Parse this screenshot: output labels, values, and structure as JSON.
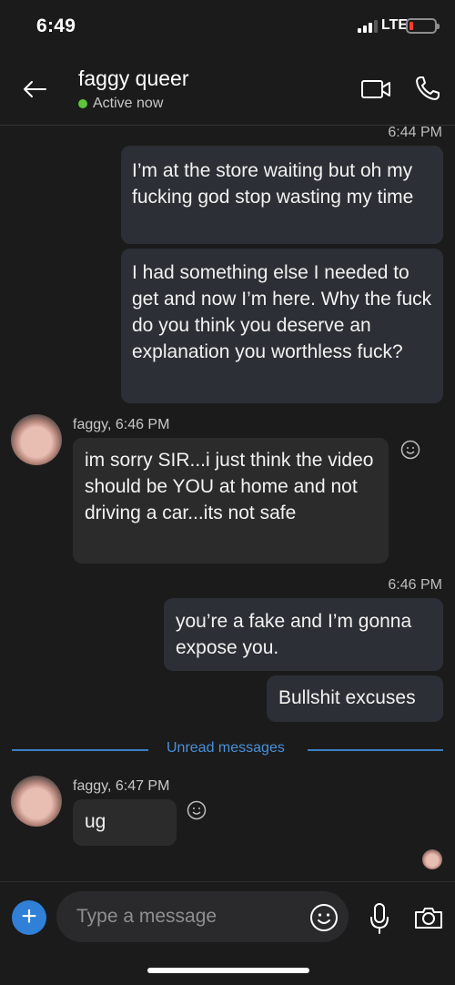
{
  "status_bar": {
    "time": "6:49",
    "network": "LTE",
    "battery_level": 0.08
  },
  "header": {
    "contact_name": "faggy queer",
    "presence": "Active now",
    "icons": [
      "back-arrow-icon",
      "video-call-icon",
      "phone-icon"
    ]
  },
  "conversation": {
    "timestamp_1": "6:44 PM",
    "out_1": "I’m at the store waiting but oh my fucking god stop wasting my time",
    "out_2": "I had something else I needed to get and now I’m here. Why the fuck do you think you deserve an explanation you worthless fuck?",
    "in_1_sender": "faggy, 6:46 PM",
    "in_1": "im sorry SIR...i just think the video should be YOU at home and not driving a car...its not safe",
    "timestamp_2": "6:46 PM",
    "out_3": "you’re a fake and I’m gonna expose you.",
    "out_4": "Bullshit excuses",
    "unread_label": "Unread messages",
    "in_2_sender": "faggy, 6:47 PM",
    "in_2": "ug"
  },
  "composer": {
    "placeholder": "Type a message",
    "plus_label": "+"
  },
  "colors": {
    "background": "#1b1b1b",
    "outgoing_bubble": "#2c2f35",
    "incoming_bubble": "#2b2b2b",
    "accent": "#2f80d6",
    "presence_green": "#5ec43b",
    "battery_red": "#ff3b30"
  }
}
